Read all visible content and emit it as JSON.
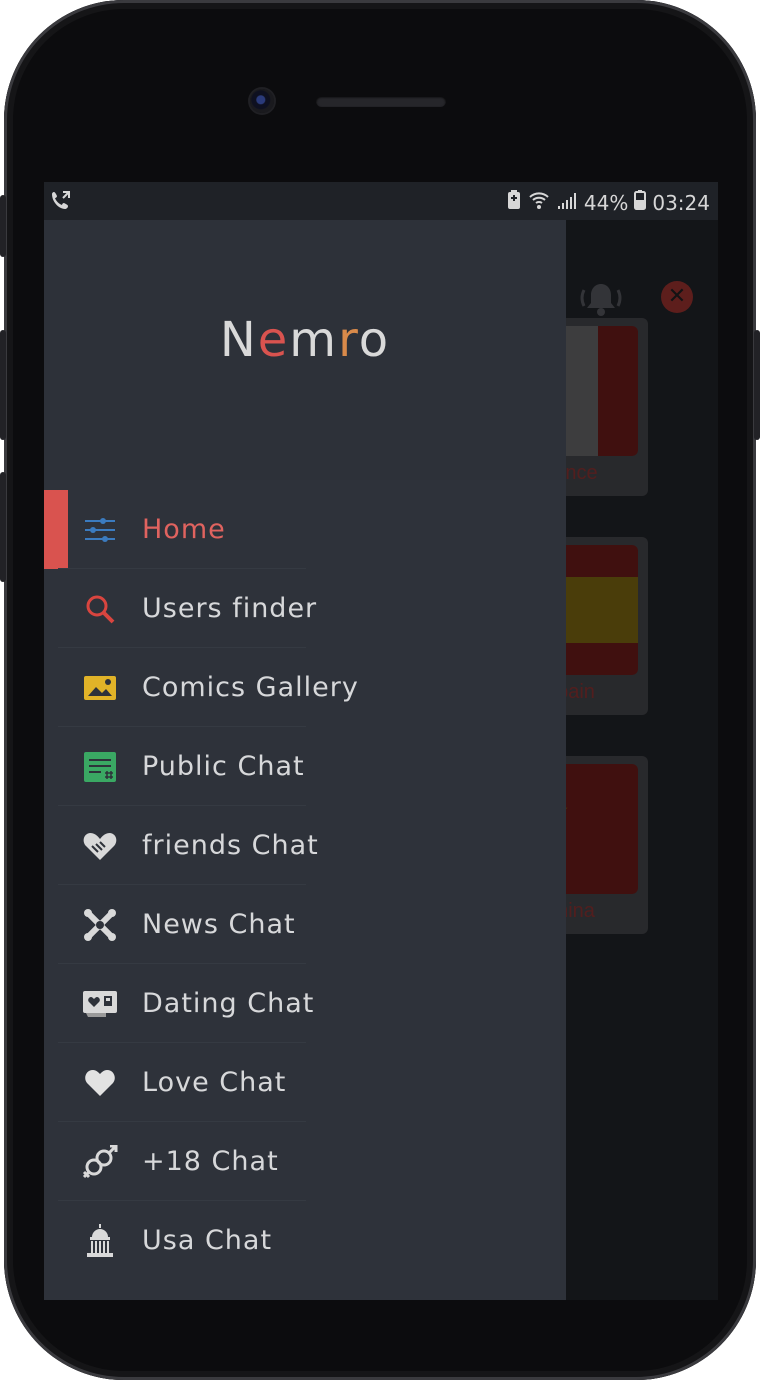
{
  "status_bar": {
    "battery_percent": "44%",
    "time": "03:24",
    "icons": [
      "call-forward-icon",
      "battery-charging-icon",
      "wifi-icon",
      "signal-icon",
      "battery-icon"
    ]
  },
  "background_app": {
    "cards": [
      {
        "name": "ance"
      },
      {
        "name": "pain"
      },
      {
        "name": "hina"
      }
    ]
  },
  "drawer": {
    "logo": {
      "n": "N",
      "e": "e",
      "m": "m",
      "r": "r",
      "o": "o"
    },
    "menu": [
      {
        "label": "Home",
        "icon": "sliders-icon",
        "active": true
      },
      {
        "label": "Users finder",
        "icon": "search-icon"
      },
      {
        "label": "Comics Gallery",
        "icon": "image-icon"
      },
      {
        "label": "Public Chat",
        "icon": "chat-list-icon"
      },
      {
        "label": "friends Chat",
        "icon": "handshake-heart-icon"
      },
      {
        "label": "News Chat",
        "icon": "joomla-icon"
      },
      {
        "label": "Dating Chat",
        "icon": "dating-card-icon"
      },
      {
        "label": "Love Chat",
        "icon": "heart-icon"
      },
      {
        "label": "+18 Chat",
        "icon": "gender-icon"
      },
      {
        "label": "Usa Chat",
        "icon": "capitol-icon"
      }
    ]
  },
  "colors": {
    "accent": "#d9534f",
    "drawer_bg": "#2e323a",
    "text": "#d7d8da"
  }
}
